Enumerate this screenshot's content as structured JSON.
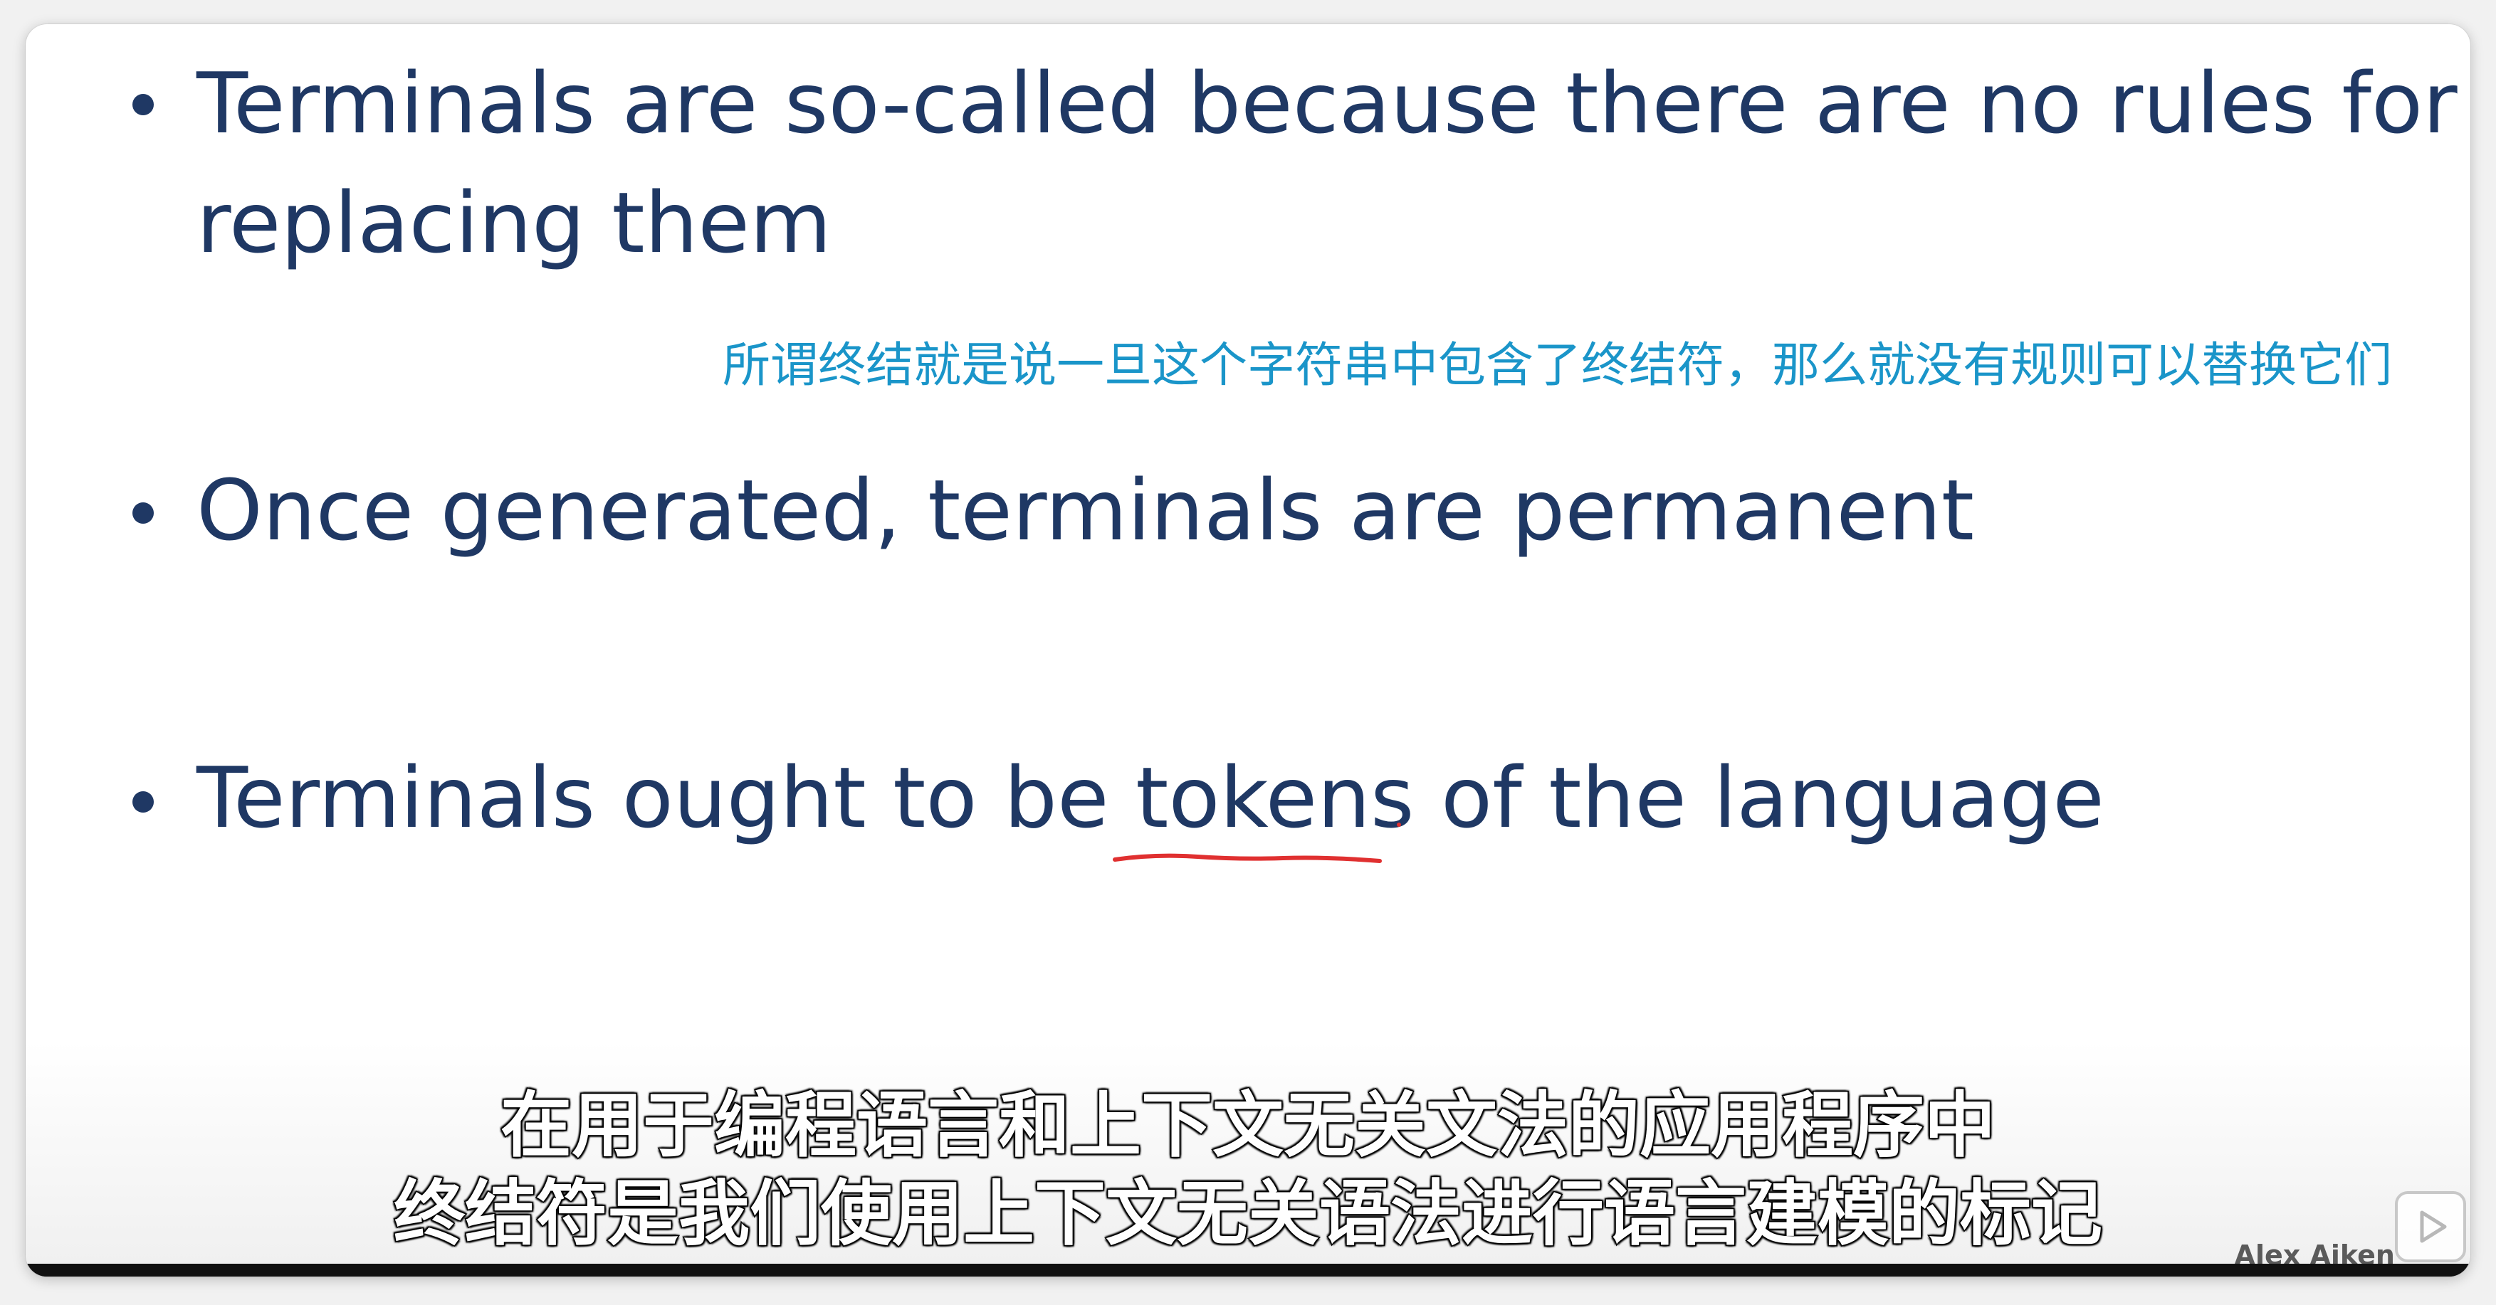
{
  "slide": {
    "bullets": [
      {
        "lines": [
          "Terminals are so-called because there are no rules for",
          "replacing them"
        ]
      },
      {
        "lines": [
          "Once generated, terminals are permanent"
        ]
      },
      {
        "lines": [
          "Terminals ought to be tokens of the language"
        ]
      }
    ],
    "annotation_cn": "所谓终结就是说一旦这个字符串中包含了终结符，那么就没有规则可以替换它们"
  },
  "subtitles": {
    "line1": "在用于编程语言和上下文无关文法的应用程序中",
    "line2": "终结符是我们使用上下文无关语法进行语言建模的标记"
  },
  "watermark": "Alex Aiken",
  "player": {
    "button_icon": "play-icon",
    "progress": 1.0
  },
  "colors": {
    "text_primary": "#1f3864",
    "annotation": "#1a95c9",
    "underline": "#e03030"
  }
}
